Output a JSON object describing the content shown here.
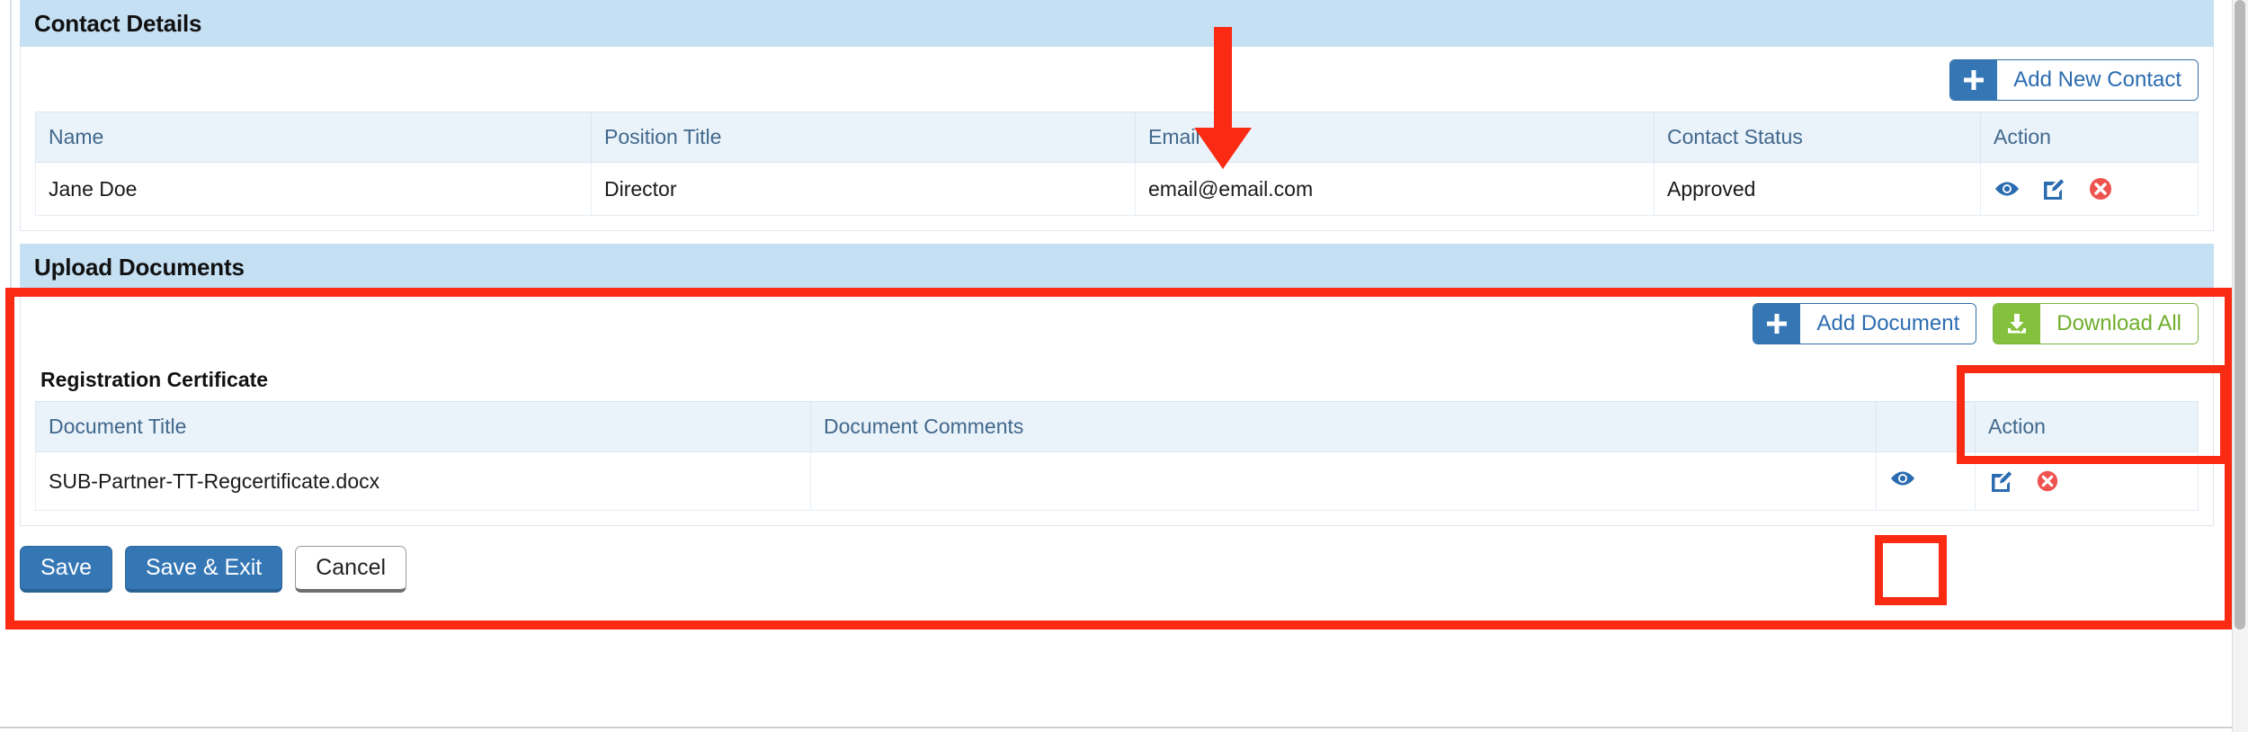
{
  "contact_section": {
    "title": "Contact Details",
    "add_button": {
      "label": "Add New Contact",
      "icon": "plus-icon"
    },
    "table": {
      "columns": [
        "Name",
        "Position Title",
        "Email",
        "Contact Status",
        "Action"
      ],
      "rows": [
        {
          "name": "Jane Doe",
          "position_title": "Director",
          "email": "email@email.com",
          "contact_status": "Approved",
          "actions": [
            "view-icon",
            "edit-icon",
            "delete-icon"
          ]
        }
      ]
    }
  },
  "upload_section": {
    "title": "Upload Documents",
    "add_button": {
      "label": "Add Document",
      "icon": "plus-icon"
    },
    "download_button": {
      "label": "Download All",
      "icon": "download-icon"
    },
    "subsection_title": "Registration Certificate",
    "table": {
      "columns": [
        "Document Title",
        "Document Comments",
        "",
        "Action"
      ],
      "rows": [
        {
          "document_title": "SUB-Partner-TT-Regcertificate.docx",
          "document_comments": "",
          "preview_action": "view-icon",
          "actions": [
            "edit-icon",
            "delete-icon"
          ]
        }
      ]
    }
  },
  "footer": {
    "save_label": "Save",
    "save_exit_label": "Save & Exit",
    "cancel_label": "Cancel"
  },
  "annotations": {
    "arrow_color": "#fb2a13",
    "highlight_color": "#fb2a13",
    "arrow_target": "contact-row-email",
    "boxes": [
      "upload-documents-section",
      "download-all-button",
      "document-preview-icon"
    ]
  },
  "colors": {
    "panel_header_bg": "#c5dff3",
    "table_header_bg": "#eaf2fa",
    "primary_blue": "#3577b5",
    "link_blue": "#2b6cb0",
    "green": "#84c13c",
    "danger_red": "#ef5350"
  }
}
